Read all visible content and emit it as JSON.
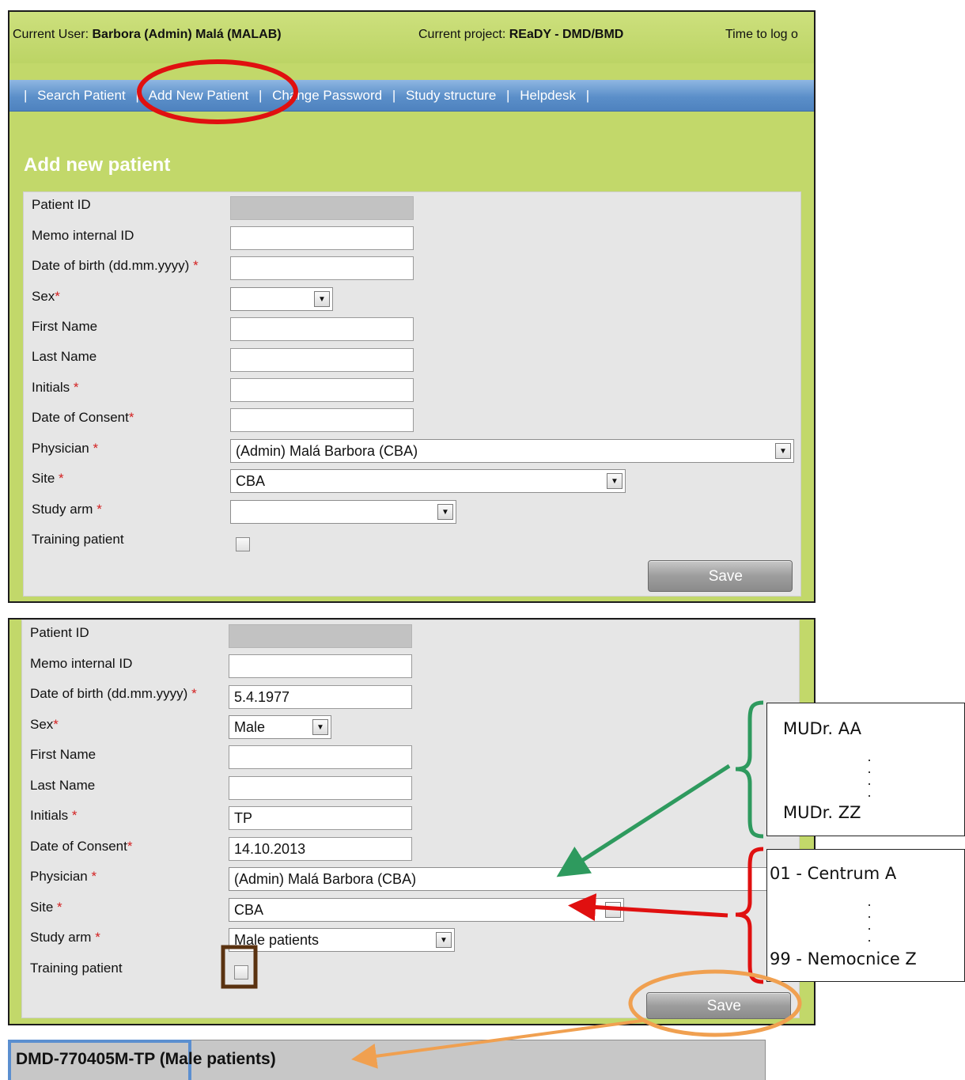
{
  "header": {
    "current_user_label": "Current User:",
    "current_user_value": "Barbora (Admin) Malá (MALAB)",
    "current_project_label": "Current project:",
    "current_project_value": "REaDY - DMD/BMD",
    "time_to_log": "Time to log o"
  },
  "nav": {
    "items": [
      {
        "label": "Search Patient"
      },
      {
        "label": "Add New Patient"
      },
      {
        "label": "Change Password"
      },
      {
        "label": "Study structure"
      },
      {
        "label": "Helpdesk"
      }
    ],
    "separator": "|"
  },
  "page_title": "Add new patient",
  "form": {
    "labels": {
      "patient_id": "Patient ID",
      "memo_id": "Memo internal ID",
      "dob": "Date of birth (dd.mm.yyyy)",
      "sex": "Sex",
      "first_name": "First Name",
      "last_name": "Last Name",
      "initials": "Initials",
      "consent": "Date of Consent",
      "physician": "Physician",
      "site": "Site",
      "study_arm": "Study arm",
      "training": "Training patient"
    },
    "required_mark": "*",
    "save_label": "Save"
  },
  "empty_form": {
    "patient_id": "",
    "memo_id": "",
    "dob": "",
    "sex": "",
    "first_name": "",
    "last_name": "",
    "initials": "",
    "consent": "",
    "physician": "(Admin) Malá Barbora (CBA)",
    "site": "CBA",
    "study_arm": "",
    "training_checked": false
  },
  "filled_form": {
    "patient_id": "",
    "memo_id": "",
    "dob": "5.4.1977",
    "sex": "Male",
    "first_name": "",
    "last_name": "",
    "initials": "TP",
    "consent": "14.10.2013",
    "physician": "(Admin) Malá Barbora (CBA)",
    "site": "CBA",
    "study_arm": "Male patients",
    "training_checked": false
  },
  "physician_options_note": {
    "first": "MUDr. AA",
    "last": "MUDr. ZZ"
  },
  "site_options_note": {
    "first": "01 - Centrum A",
    "last": "99 - Nemocnice Z"
  },
  "result": {
    "code": "DMD-770405M-TP",
    "arm": "(Male patients)"
  },
  "colors": {
    "page_green": "#c2d86a",
    "nav_blue": "#5b8fc9",
    "form_gray": "#e6e6e6",
    "annotation_red": "#e01010",
    "annotation_green": "#2e9a5e",
    "annotation_orange": "#f0a050",
    "annotation_brown": "#5a3210",
    "annotation_blue": "#5b8fd0"
  }
}
